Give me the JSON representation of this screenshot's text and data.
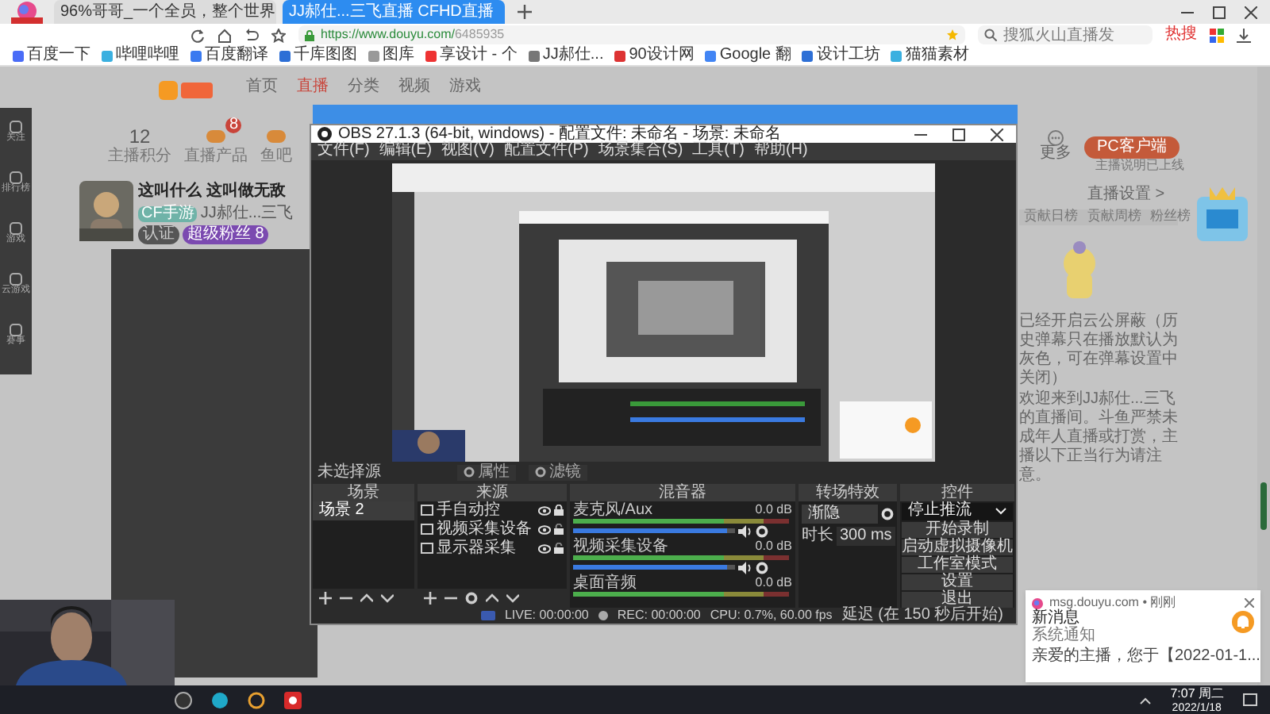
{
  "browser": {
    "tabs": [
      {
        "label": "96%哥哥_一个全员，整个世界",
        "selected": false
      },
      {
        "label": "JJ郝仕...三飞直播 CFHD直播",
        "selected": true
      }
    ],
    "url_host": "https://www.douyu.com/",
    "url_path": "6485935",
    "search_placeholder": "搜狐火山直播发",
    "hot_label": "热搜",
    "bookmarks": [
      "百度一下",
      "哔哩哔哩",
      "百度翻译",
      "千库图图",
      "图库",
      "享设计 - 个",
      "JJ郝仕...",
      "90设计网",
      "Google 翻",
      "设计工坊",
      "猫猫素材"
    ]
  },
  "site": {
    "nav": [
      {
        "label": "首页",
        "selected": false
      },
      {
        "label": "直播",
        "selected": true
      },
      {
        "label": "分类",
        "selected": false
      },
      {
        "label": "视频",
        "selected": false
      },
      {
        "label": "游戏",
        "selected": false
      }
    ],
    "sidebar": [
      "关注",
      "排行榜",
      "游戏",
      "云游戏",
      "赛事"
    ],
    "stats": [
      {
        "value": "12",
        "label": "主播积分"
      },
      {
        "label": "直播产品",
        "badge": "8"
      },
      {
        "label": "鱼吧"
      }
    ],
    "streamer": {
      "title": "这叫什么 这叫做无敌",
      "category": "CF手游",
      "name": "JJ郝仕...三飞",
      "tags": [
        "认证",
        "超级粉丝 8"
      ]
    },
    "client_button": "PC客户端",
    "client_note": "主播说明已上线",
    "more": "更多",
    "settings_link": "直播设置 >",
    "rank_tabs": [
      "贡献日榜",
      "贡献周榜",
      "粉丝榜"
    ],
    "notice": "已经开启云公屏蔽（历史弹幕只在播放默认为灰色，可在弹幕设置中关闭）",
    "welcome": "欢迎来到JJ郝仕...三飞的直播间。斗鱼严禁未成年人直播或打赏，主播以下正当行为请注意。"
  },
  "obs": {
    "title": "OBS 27.1.3 (64-bit, windows) - 配置文件: 未命名 - 场景: 未命名",
    "menu": [
      "文件(F)",
      "编辑(E)",
      "视图(V)",
      "配置文件(P)",
      "场景集合(S)",
      "工具(T)",
      "帮助(H)"
    ],
    "preview": {
      "kind": "picture"
    },
    "source_status": "未选择源",
    "source_buttons": [
      "属性",
      "滤镜"
    ],
    "scenes": {
      "title": "场景",
      "items": [
        {
          "label": "场景 2",
          "selected": true
        }
      ]
    },
    "sources": {
      "title": "来源",
      "items": [
        {
          "label": "手自动控",
          "visible": true,
          "locked": true
        },
        {
          "label": "视频采集设备",
          "visible": true,
          "locked": false
        },
        {
          "label": "显示器采集",
          "visible": true,
          "locked": false
        }
      ]
    },
    "mixer": {
      "title": "混音器",
      "channels": [
        {
          "name": "麦克风/Aux",
          "reading": "0.0 dB",
          "level": 0.95
        },
        {
          "name": "视频采集设备",
          "reading": "0.0 dB",
          "level": 0.95
        },
        {
          "name": "桌面音频",
          "reading": "0.0 dB"
        }
      ]
    },
    "transitions": {
      "title": "转场特效",
      "type": "渐隐",
      "duration_label": "时长",
      "duration": "300 ms"
    },
    "controls": {
      "title": "控件",
      "buttons": [
        {
          "label": "停止推流",
          "kind": "dropdown"
        },
        {
          "label": "开始录制",
          "kind": "button"
        },
        {
          "label": "启动虚拟摄像机",
          "kind": "button"
        },
        {
          "label": "工作室模式",
          "kind": "button"
        },
        {
          "label": "设置",
          "kind": "button"
        },
        {
          "label": "退出",
          "kind": "button"
        }
      ]
    },
    "status": {
      "live": "LIVE: 00:00:00",
      "rec": "REC: 00:00:00",
      "cpu": "CPU: 0.7%, 60.00 fps",
      "delay": "延迟 (在 150 秒后开始)"
    }
  },
  "webcam": {
    "kind": "picture"
  },
  "notification": {
    "source": "msg.douyu.com • 刚刚",
    "title": "新消息",
    "subtitle": "系统通知",
    "body": "亲爱的主播，您于【2022-01-1..."
  },
  "taskbar": {
    "time": "7:07 周二",
    "date": "2022/1/18"
  }
}
